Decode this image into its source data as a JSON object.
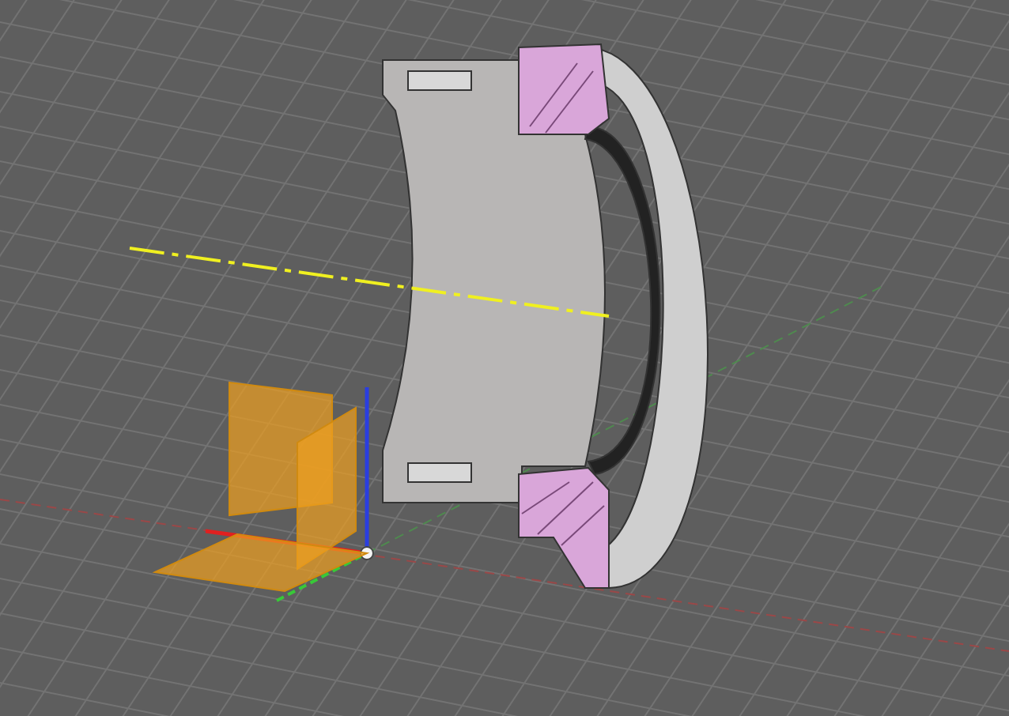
{
  "viewport": {
    "grid": true,
    "origin_planes": true,
    "origin_axes": true,
    "center_axis": true,
    "section_part": true
  }
}
